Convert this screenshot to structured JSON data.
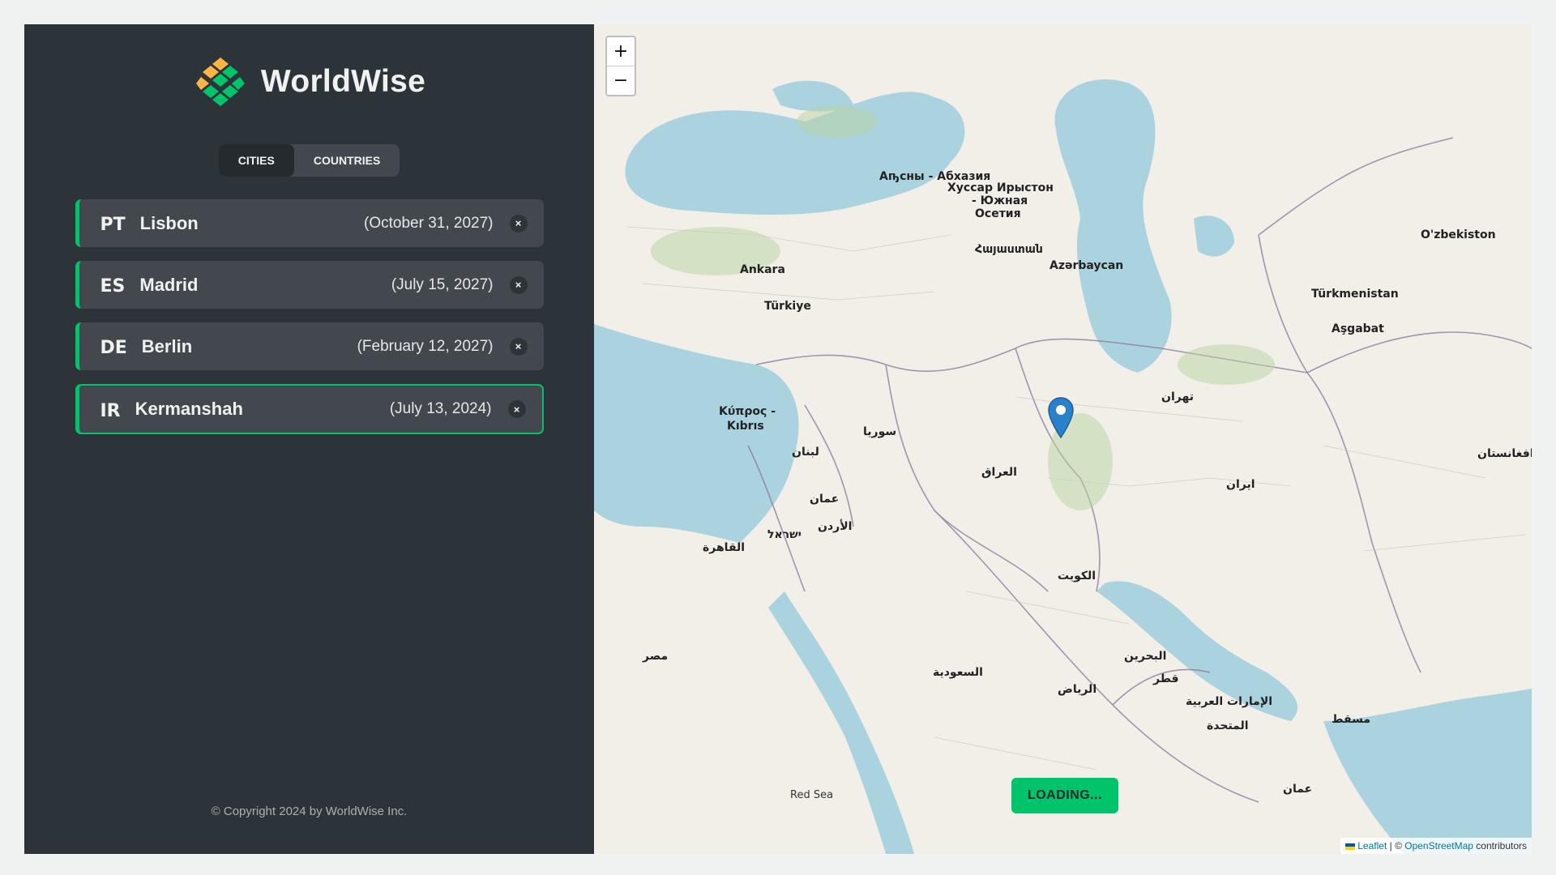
{
  "brand": {
    "name": "WorldWise"
  },
  "tabs": [
    {
      "label": "Cities",
      "active": true
    },
    {
      "label": "Countries",
      "active": false
    }
  ],
  "cities": [
    {
      "code": "PT",
      "name": "Lisbon",
      "date": "(October 31, 2027)",
      "delete": "×"
    },
    {
      "code": "ES",
      "name": "Madrid",
      "date": "(July 15, 2027)",
      "delete": "×"
    },
    {
      "code": "DE",
      "name": "Berlin",
      "date": "(February 12, 2027)",
      "delete": "×"
    },
    {
      "code": "IR",
      "name": "Kermanshah",
      "date": "(July 13, 2024)",
      "delete": "×",
      "active": true
    }
  ],
  "footer": {
    "copyright": "© Copyright 2024 by WorldWise Inc."
  },
  "map": {
    "zoom_in": "+",
    "zoom_out": "−",
    "loading": "LOADING...",
    "labels": {
      "ankara": "Ankara",
      "turkiye": "Türkiye",
      "kypros": "Κύπρος -",
      "kibris": "Kıbrıs",
      "azerbaycan": "Azərbaycan",
      "turkmenistan": "Türkmenistan",
      "asgabat": "Aşgabat",
      "uzbekiston": "O'zbekiston",
      "abkhazia": "Аҧсны - Абхазия",
      "ossetia1": "Хуссар Ирыстон",
      "ossetia2": "- Южная",
      "ossetia3": "Осетия",
      "armenia": "Հայաստան",
      "syria": "سوريا",
      "lebanon": "لبنان",
      "iraq": "العراق",
      "iran": "ایران",
      "tehran": "تهران",
      "amman": "عمان",
      "jordan": "الأردن",
      "israel": "ישראל",
      "cairo": "القاهرة",
      "egypt": "مصر",
      "kuwait": "الكويت",
      "saudi": "السعودية",
      "riyadh": "الرياض",
      "bahrain": "البحرين",
      "qatar": "قطر",
      "uae1": "الإمارات العربية",
      "uae2": "المتحدة",
      "muscat": "مسقط",
      "oman": "عمان",
      "afghanistan": "افغانستان",
      "redsea": "Red Sea"
    },
    "attribution": {
      "leaflet": "Leaflet",
      "sep": " | © ",
      "osm": "OpenStreetMap",
      "suffix": " contributors"
    }
  },
  "colors": {
    "accent": "#00c46a",
    "sidebar": "#2d3439",
    "water": "#aad3df",
    "land": "#f2efe9"
  }
}
